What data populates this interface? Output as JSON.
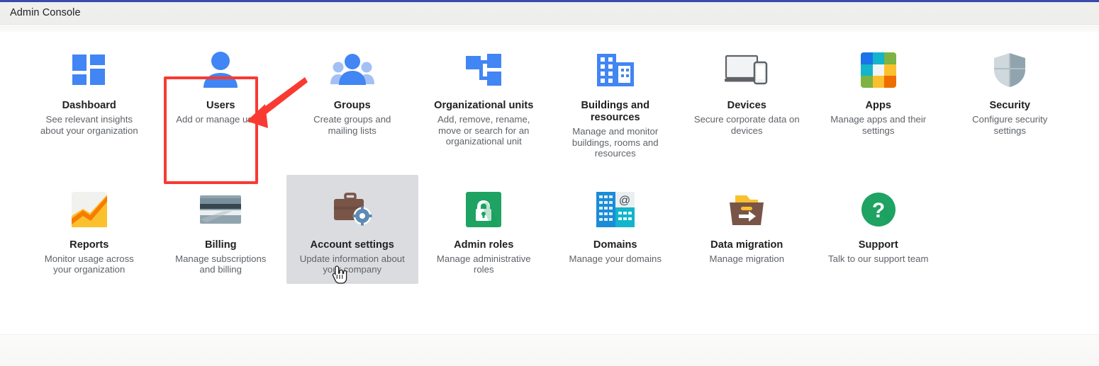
{
  "window": {
    "title": "Admin Console",
    "accent_color": "#3b4aab",
    "header_bg": "#efefed"
  },
  "annotation": {
    "highlight_color": "#f93a32",
    "highlight_target": "Users",
    "arrow_color": "#f93a32",
    "cursor_target": "Account settings"
  },
  "tiles": [
    {
      "id": "dashboard",
      "icon": "dashboard-grid-icon",
      "label": "Dashboard",
      "desc": "See relevant insights about your organization",
      "hovered": false
    },
    {
      "id": "users",
      "icon": "person-icon",
      "label": "Users",
      "desc": "Add or manage users",
      "hovered": false
    },
    {
      "id": "groups",
      "icon": "people-group-icon",
      "label": "Groups",
      "desc": "Create groups and mailing lists",
      "hovered": false
    },
    {
      "id": "organizational-units",
      "icon": "org-tree-icon",
      "label": "Organizational units",
      "desc": "Add, remove, rename, move or search for an organizational unit",
      "hovered": false
    },
    {
      "id": "buildings-and-resources",
      "icon": "buildings-icon",
      "label": "Buildings and resources",
      "desc": "Manage and monitor buildings, rooms and resources",
      "hovered": false
    },
    {
      "id": "devices",
      "icon": "devices-laptop-phone-icon",
      "label": "Devices",
      "desc": "Secure corporate data on devices",
      "hovered": false
    },
    {
      "id": "apps",
      "icon": "apps-color-grid-icon",
      "label": "Apps",
      "desc": "Manage apps and their settings",
      "hovered": false
    },
    {
      "id": "security",
      "icon": "shield-icon",
      "label": "Security",
      "desc": "Configure security settings",
      "hovered": false
    },
    {
      "id": "reports",
      "icon": "analytics-chart-icon",
      "label": "Reports",
      "desc": "Monitor usage across your organization",
      "hovered": false
    },
    {
      "id": "billing",
      "icon": "credit-card-icon",
      "label": "Billing",
      "desc": "Manage subscriptions and billing",
      "hovered": false
    },
    {
      "id": "account-settings",
      "icon": "briefcase-gear-icon",
      "label": "Account settings",
      "desc": "Update information about your company",
      "hovered": true
    },
    {
      "id": "admin-roles",
      "icon": "lock-icon",
      "label": "Admin roles",
      "desc": "Manage administrative roles",
      "hovered": false
    },
    {
      "id": "domains",
      "icon": "domain-at-icon",
      "label": "Domains",
      "desc": "Manage your domains",
      "hovered": false
    },
    {
      "id": "data-migration",
      "icon": "migration-box-arrow-icon",
      "label": "Data migration",
      "desc": "Manage migration",
      "hovered": false
    },
    {
      "id": "support",
      "icon": "question-circle-icon",
      "label": "Support",
      "desc": "Talk to our support team",
      "hovered": false
    }
  ],
  "colors": {
    "blue": "#4285f4",
    "blue_dark": "#3367d6",
    "green": "#1ea362",
    "gray_icon": "#94a2ad",
    "brown": "#795548",
    "orange": "#f9a825",
    "hover_bg": "#dadce0"
  }
}
